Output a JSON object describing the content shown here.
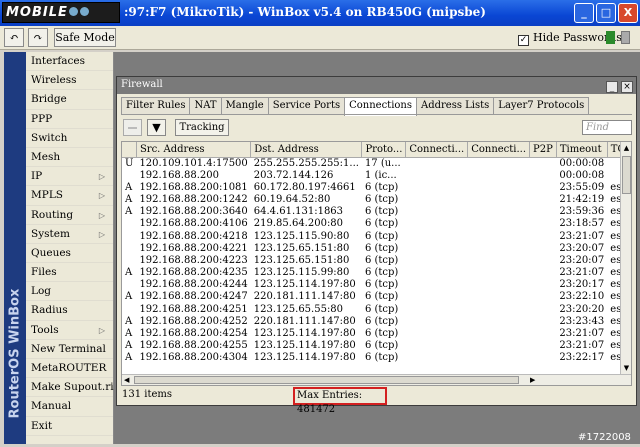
{
  "window": {
    "title": ":97:F7 (MikroTik) - WinBox v5.4 on RB450G (mipsbe)",
    "logo_text": "MOBILE",
    "buttons": [
      "_",
      "□",
      "X"
    ]
  },
  "toolbar": {
    "undo_icon": "undo-icon",
    "redo_icon": "redo-icon",
    "safe_mode": "Safe Mode",
    "hide_passwords": "Hide Passwords",
    "hide_passwords_checked": true
  },
  "sidebar": {
    "brand": "RouterOS WinBox",
    "items": [
      {
        "label": "Interfaces",
        "submenu": false
      },
      {
        "label": "Wireless",
        "submenu": false
      },
      {
        "label": "Bridge",
        "submenu": false
      },
      {
        "label": "PPP",
        "submenu": false
      },
      {
        "label": "Switch",
        "submenu": false
      },
      {
        "label": "Mesh",
        "submenu": false
      },
      {
        "label": "IP",
        "submenu": true
      },
      {
        "label": "MPLS",
        "submenu": true
      },
      {
        "label": "Routing",
        "submenu": true
      },
      {
        "label": "System",
        "submenu": true
      },
      {
        "label": "Queues",
        "submenu": false
      },
      {
        "label": "Files",
        "submenu": false
      },
      {
        "label": "Log",
        "submenu": false
      },
      {
        "label": "Radius",
        "submenu": false
      },
      {
        "label": "Tools",
        "submenu": true
      },
      {
        "label": "New Terminal",
        "submenu": false
      },
      {
        "label": "MetaROUTER",
        "submenu": false
      },
      {
        "label": "Make Supout.rif",
        "submenu": false
      },
      {
        "label": "Manual",
        "submenu": false
      },
      {
        "label": "Exit",
        "submenu": false
      }
    ]
  },
  "firewall": {
    "title": "Firewall",
    "tabs": [
      "Filter Rules",
      "NAT",
      "Mangle",
      "Service Ports",
      "Connections",
      "Address Lists",
      "Layer7 Protocols"
    ],
    "active_tab": "Connections",
    "tracking": "Tracking",
    "find_placeholder": "Find",
    "columns": [
      "",
      "Src. Address",
      "Dst. Address",
      "Proto...",
      "Connecti...",
      "Connecti...",
      "P2P",
      "Timeout",
      "TCP State"
    ],
    "rows": [
      [
        "U",
        "120.109.101.4:17500",
        "255.255.255.255:1...",
        "17 (u...",
        "",
        "",
        "",
        "00:00:08",
        ""
      ],
      [
        "",
        "192.168.88.200",
        "203.72.144.126",
        "1 (ic...",
        "",
        "",
        "",
        "00:00:08",
        ""
      ],
      [
        "A",
        "192.168.88.200:1081",
        "60.172.80.197:4661",
        "6 (tcp)",
        "",
        "",
        "",
        "23:55:09",
        "established"
      ],
      [
        "A",
        "192.168.88.200:1242",
        "60.19.64.52:80",
        "6 (tcp)",
        "",
        "",
        "",
        "21:42:19",
        "established"
      ],
      [
        "A",
        "192.168.88.200:3640",
        "64.4.61.131:1863",
        "6 (tcp)",
        "",
        "",
        "",
        "23:59:36",
        "established"
      ],
      [
        "",
        "192.168.88.200:4106",
        "219.85.64.200:80",
        "6 (tcp)",
        "",
        "",
        "",
        "23:18:57",
        "established"
      ],
      [
        "",
        "192.168.88.200:4218",
        "123.125.115.90:80",
        "6 (tcp)",
        "",
        "",
        "",
        "23:21:07",
        "established"
      ],
      [
        "",
        "192.168.88.200:4221",
        "123.125.65.151:80",
        "6 (tcp)",
        "",
        "",
        "",
        "23:20:07",
        "established"
      ],
      [
        "",
        "192.168.88.200:4223",
        "123.125.65.151:80",
        "6 (tcp)",
        "",
        "",
        "",
        "23:20:07",
        "established"
      ],
      [
        "A",
        "192.168.88.200:4235",
        "123.125.115.99:80",
        "6 (tcp)",
        "",
        "",
        "",
        "23:21:07",
        "established"
      ],
      [
        "",
        "192.168.88.200:4244",
        "123.125.114.197:80",
        "6 (tcp)",
        "",
        "",
        "",
        "23:20:17",
        "established"
      ],
      [
        "A",
        "192.168.88.200:4247",
        "220.181.111.147:80",
        "6 (tcp)",
        "",
        "",
        "",
        "23:22:10",
        "established"
      ],
      [
        "",
        "192.168.88.200:4251",
        "123.125.65.55:80",
        "6 (tcp)",
        "",
        "",
        "",
        "23:20:20",
        "established"
      ],
      [
        "A",
        "192.168.88.200:4252",
        "220.181.111.147:80",
        "6 (tcp)",
        "",
        "",
        "",
        "23:23:43",
        "established"
      ],
      [
        "A",
        "192.168.88.200:4254",
        "123.125.114.197:80",
        "6 (tcp)",
        "",
        "",
        "",
        "23:21:07",
        "established"
      ],
      [
        "A",
        "192.168.88.200:4255",
        "123.125.114.197:80",
        "6 (tcp)",
        "",
        "",
        "",
        "23:21:07",
        "established"
      ],
      [
        "A",
        "192.168.88.200:4304",
        "123.125.114.197:80",
        "6 (tcp)",
        "",
        "",
        "",
        "23:22:17",
        "established"
      ]
    ],
    "status_count": "131 items",
    "max_entries": "Max Entries: 481472"
  },
  "watermark": "#1722008",
  "colors": {
    "titlebar": "#0a46d4",
    "brand": "#1e3b80",
    "highlight": "#d32020"
  }
}
